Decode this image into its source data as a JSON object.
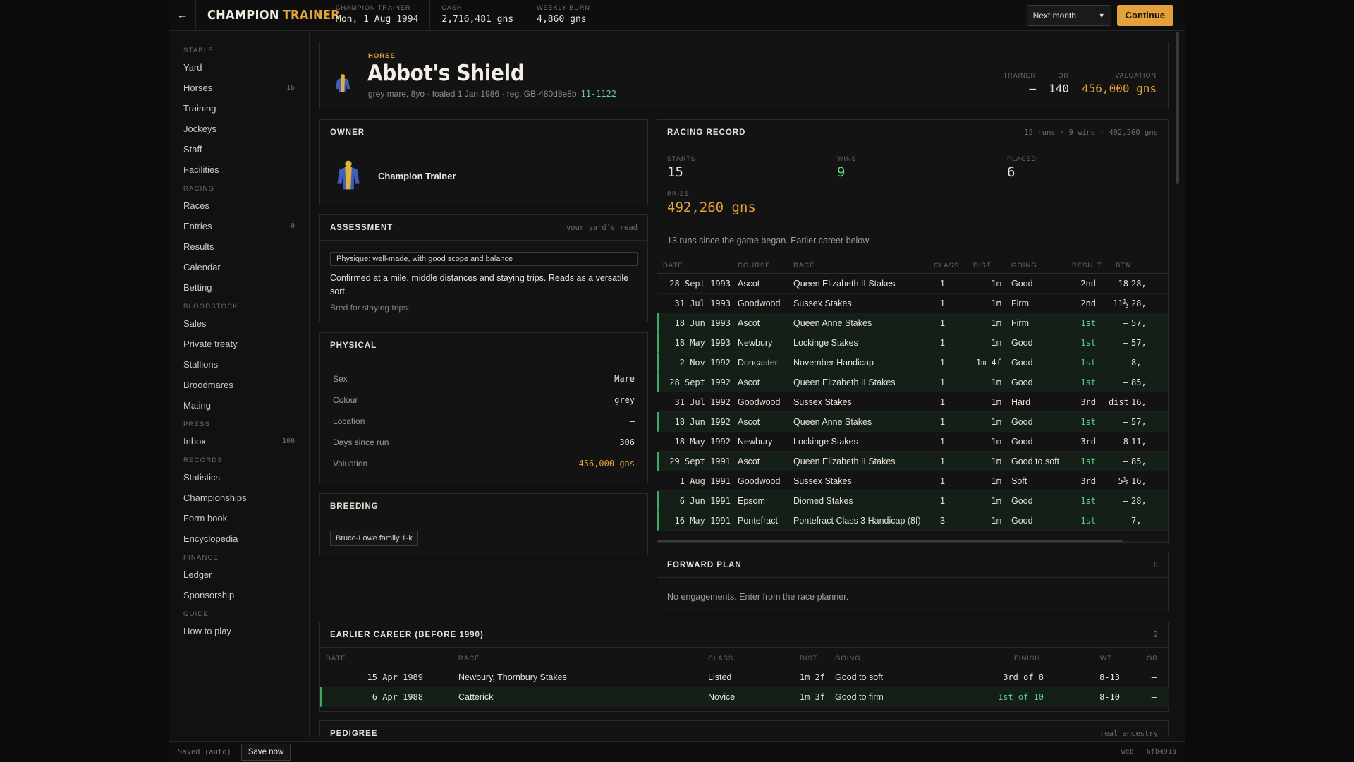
{
  "app": {
    "brand_a": "CHAMPION",
    "brand_b": "TRAINER",
    "back_icon": "arrow-left-icon"
  },
  "topbar": {
    "stats": [
      {
        "label": "CHAMPION TRAINER",
        "value": "Mon, 1 Aug 1994"
      },
      {
        "label": "CASH",
        "value": "2,716,481 gns"
      },
      {
        "label": "WEEKLY BURN",
        "value": "4,860 gns"
      }
    ],
    "period_select": "Next month",
    "continue_label": "Continue"
  },
  "sidebar": {
    "sections": [
      {
        "title": "STABLE",
        "items": [
          {
            "label": "Yard",
            "count": ""
          },
          {
            "label": "Horses",
            "count": "16"
          },
          {
            "label": "Training",
            "count": ""
          },
          {
            "label": "Jockeys",
            "count": ""
          },
          {
            "label": "Staff",
            "count": ""
          },
          {
            "label": "Facilities",
            "count": ""
          }
        ]
      },
      {
        "title": "RACING",
        "items": [
          {
            "label": "Races",
            "count": ""
          },
          {
            "label": "Entries",
            "count": "0"
          },
          {
            "label": "Results",
            "count": ""
          },
          {
            "label": "Calendar",
            "count": ""
          },
          {
            "label": "Betting",
            "count": ""
          }
        ]
      },
      {
        "title": "BLOODSTOCK",
        "items": [
          {
            "label": "Sales",
            "count": ""
          },
          {
            "label": "Private treaty",
            "count": ""
          },
          {
            "label": "Stallions",
            "count": ""
          },
          {
            "label": "Broodmares",
            "count": ""
          },
          {
            "label": "Mating",
            "count": ""
          }
        ]
      },
      {
        "title": "PRESS",
        "items": [
          {
            "label": "Inbox",
            "count": "100"
          }
        ]
      },
      {
        "title": "RECORDS",
        "items": [
          {
            "label": "Statistics",
            "count": ""
          },
          {
            "label": "Championships",
            "count": ""
          },
          {
            "label": "Form book",
            "count": ""
          },
          {
            "label": "Encyclopedia",
            "count": ""
          }
        ]
      },
      {
        "title": "FINANCE",
        "items": [
          {
            "label": "Ledger",
            "count": ""
          },
          {
            "label": "Sponsorship",
            "count": ""
          }
        ]
      },
      {
        "title": "GUIDE",
        "items": [
          {
            "label": "How to play",
            "count": ""
          }
        ]
      }
    ]
  },
  "horse": {
    "label": "HORSE",
    "name": "Abbot's Shield",
    "desc": "grey mare, 8yo · foaled 1 Jan 1986 · reg. GB-480d8e8b",
    "form": "11-1122",
    "stats": [
      {
        "label": "TRAINER",
        "value": "—"
      },
      {
        "label": "OR",
        "value": "140"
      },
      {
        "label": "VALUATION",
        "value": "456,000 gns"
      }
    ],
    "colors": {
      "silk_blue": "#3f5fb8",
      "silk_gold": "#e0b23a"
    }
  },
  "owner": {
    "title": "OWNER",
    "name": "Champion Trainer"
  },
  "assessment": {
    "title": "ASSESSMENT",
    "note": "your yard's read",
    "physique": "Physique: well-made, with good scope and balance",
    "text": "Confirmed at a mile, middle distances and staying trips. Reads as a versatile sort.",
    "sub": "Bred for staying trips."
  },
  "physical": {
    "title": "PHYSICAL",
    "rows": [
      {
        "k": "Sex",
        "v": "Mare"
      },
      {
        "k": "Colour",
        "v": "grey"
      },
      {
        "k": "Location",
        "v": "—"
      },
      {
        "k": "Days since run",
        "v": "306"
      },
      {
        "k": "Valuation",
        "v": "456,000 gns"
      }
    ]
  },
  "breeding": {
    "title": "BREEDING",
    "family": "Bruce-Lowe family 1-k"
  },
  "record": {
    "title": "RACING RECORD",
    "note": "15 runs · 9 wins · 492,260 gns",
    "starts_label": "STARTS",
    "starts": "15",
    "wins_label": "WINS",
    "wins": "9",
    "placed_label": "PLACED",
    "placed": "6",
    "prize_label": "PRIZE",
    "prize": "492,260 gns",
    "runs_note": "13 runs since the game began. Earlier career below.",
    "headers": {
      "date": "DATE",
      "course": "COURSE",
      "race": "RACE",
      "class": "CLASS",
      "dist": "DIST",
      "going": "GOING",
      "result": "RESULT",
      "btn": "BTN"
    },
    "rows": [
      {
        "date": "28 Sept 1993",
        "course": "Ascot",
        "race": "Queen Elizabeth II Stakes",
        "class": "1",
        "dist": "1m",
        "going": "Good",
        "result": "2nd",
        "btn": "18",
        "prize": "28,",
        "win": false
      },
      {
        "date": "31 Jul 1993",
        "course": "Goodwood",
        "race": "Sussex Stakes",
        "class": "1",
        "dist": "1m",
        "going": "Firm",
        "result": "2nd",
        "btn": "11½",
        "prize": "28,",
        "win": false
      },
      {
        "date": "18 Jun 1993",
        "course": "Ascot",
        "race": "Queen Anne Stakes",
        "class": "1",
        "dist": "1m",
        "going": "Firm",
        "result": "1st",
        "btn": "—",
        "prize": "57,",
        "win": true
      },
      {
        "date": "18 May 1993",
        "course": "Newbury",
        "race": "Lockinge Stakes",
        "class": "1",
        "dist": "1m",
        "going": "Good",
        "result": "1st",
        "btn": "—",
        "prize": "57,",
        "win": true
      },
      {
        "date": "2 Nov 1992",
        "course": "Doncaster",
        "race": "November Handicap",
        "class": "1",
        "dist": "1m 4f",
        "going": "Good",
        "result": "1st",
        "btn": "—",
        "prize": "8,",
        "win": true
      },
      {
        "date": "28 Sept 1992",
        "course": "Ascot",
        "race": "Queen Elizabeth II Stakes",
        "class": "1",
        "dist": "1m",
        "going": "Good",
        "result": "1st",
        "btn": "—",
        "prize": "85,",
        "win": true
      },
      {
        "date": "31 Jul 1992",
        "course": "Goodwood",
        "race": "Sussex Stakes",
        "class": "1",
        "dist": "1m",
        "going": "Hard",
        "result": "3rd",
        "btn": "dist",
        "prize": "16,",
        "win": false
      },
      {
        "date": "18 Jun 1992",
        "course": "Ascot",
        "race": "Queen Anne Stakes",
        "class": "1",
        "dist": "1m",
        "going": "Good",
        "result": "1st",
        "btn": "—",
        "prize": "57,",
        "win": true
      },
      {
        "date": "18 May 1992",
        "course": "Newbury",
        "race": "Lockinge Stakes",
        "class": "1",
        "dist": "1m",
        "going": "Good",
        "result": "3rd",
        "btn": "8",
        "prize": "11,",
        "win": false
      },
      {
        "date": "29 Sept 1991",
        "course": "Ascot",
        "race": "Queen Elizabeth II Stakes",
        "class": "1",
        "dist": "1m",
        "going": "Good to soft",
        "result": "1st",
        "btn": "—",
        "prize": "85,",
        "win": true
      },
      {
        "date": "1 Aug 1991",
        "course": "Goodwood",
        "race": "Sussex Stakes",
        "class": "1",
        "dist": "1m",
        "going": "Soft",
        "result": "3rd",
        "btn": "5½",
        "prize": "16,",
        "win": false
      },
      {
        "date": "6 Jun 1991",
        "course": "Epsom",
        "race": "Diomed Stakes",
        "class": "1",
        "dist": "1m",
        "going": "Good",
        "result": "1st",
        "btn": "—",
        "prize": "28,",
        "win": true
      },
      {
        "date": "16 May 1991",
        "course": "Pontefract",
        "race": "Pontefract Class 3 Handicap (8f)",
        "class": "3",
        "dist": "1m",
        "going": "Good",
        "result": "1st",
        "btn": "—",
        "prize": "7,",
        "win": true
      }
    ]
  },
  "plan": {
    "title": "FORWARD PLAN",
    "count": "0",
    "text": "No engagements. Enter from the race planner."
  },
  "early": {
    "title": "EARLIER CAREER (BEFORE 1990)",
    "count": "2",
    "headers": {
      "date": "DATE",
      "race": "RACE",
      "class": "CLASS",
      "dist": "DIST",
      "going": "GOING",
      "finish": "FINISH",
      "wt": "WT",
      "or": "OR"
    },
    "rows": [
      {
        "date": "15 Apr 1989",
        "race": "Newbury, Thornbury Stakes",
        "class": "Listed",
        "dist": "1m 2f",
        "going": "Good to soft",
        "finish": "3rd of 8",
        "wt": "8-13",
        "or": "—",
        "win": false
      },
      {
        "date": "6 Apr 1988",
        "race": "Catterick",
        "class": "Novice",
        "dist": "1m 3f",
        "going": "Good to firm",
        "finish": "1st of 10",
        "wt": "8-10",
        "or": "—",
        "win": true
      }
    ]
  },
  "pedigree": {
    "title": "PEDIGREE",
    "note": "real ancestry"
  },
  "footer": {
    "saved": "Saved (auto)",
    "save_now": "Save now",
    "build": "web · 6fb491a"
  }
}
